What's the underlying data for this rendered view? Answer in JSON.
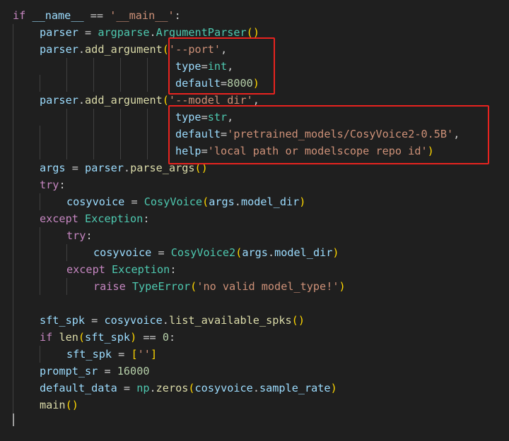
{
  "code_lines": [
    "if __name__ == '__main__':",
    "    parser = argparse.ArgumentParser()",
    "    parser.add_argument('--port',",
    "                        type=int,",
    "                        default=8000)",
    "    parser.add_argument('--model_dir',",
    "                        type=str,",
    "                        default='pretrained_models/CosyVoice2-0.5B',",
    "                        help='local path or modelscope repo id')",
    "    args = parser.parse_args()",
    "    try:",
    "        cosyvoice = CosyVoice(args.model_dir)",
    "    except Exception:",
    "        try:",
    "            cosyvoice = CosyVoice2(args.model_dir)",
    "        except Exception:",
    "            raise TypeError('no valid model_type!')",
    "",
    "    sft_spk = cosyvoice.list_available_spks()",
    "    if len(sft_spk) == 0:",
    "        sft_spk = ['']",
    "    prompt_sr = 16000",
    "    default_data = np.zeros(cosyvoice.sample_rate)",
    "    main()"
  ],
  "tokens": {
    "kw_if": "if",
    "name_dunder": "__name__",
    "op_eq": "==",
    "str_main": "'__main__'",
    "colon": ":",
    "parser": "parser",
    "assign": "=",
    "argparse": "argparse",
    "dot": ".",
    "ArgumentParser": "ArgumentParser",
    "paren_open": "(",
    "paren_close": ")",
    "add_argument": "add_argument",
    "str_port": "'--port'",
    "comma": ",",
    "type_kw": "type",
    "int_t": "int",
    "default_kw": "default",
    "num_8000": "8000",
    "str_model_dir": "'--model_dir'",
    "str_t": "str",
    "str_default_path": "'pretrained_models/CosyVoice2-0.5B'",
    "help_kw": "help",
    "str_help": "'local path or modelscope repo id'",
    "args": "args",
    "parse_args": "parse_args",
    "kw_try": "try",
    "cosyvoice": "cosyvoice",
    "CosyVoice": "CosyVoice",
    "model_dir": "model_dir",
    "kw_except": "except",
    "Exception": "Exception",
    "CosyVoice2": "CosyVoice2",
    "kw_raise": "raise",
    "TypeError": "TypeError",
    "str_no_valid": "'no valid model_type!'",
    "sft_spk": "sft_spk",
    "list_available_spks": "list_available_spks",
    "len": "len",
    "num_0": "0",
    "bracket_open": "[",
    "bracket_close": "]",
    "str_empty": "''",
    "prompt_sr": "prompt_sr",
    "num_16000": "16000",
    "default_data": "default_data",
    "np": "np",
    "zeros": "zeros",
    "sample_rate": "sample_rate",
    "main": "main"
  },
  "colors": {
    "background": "#1f1f1f",
    "keyword": "#c586c0",
    "function": "#dcdcaa",
    "class": "#4ec9b0",
    "variable": "#9cdcfe",
    "string": "#ce9178",
    "number": "#b5cea8",
    "highlight_box": "#e8231f"
  }
}
